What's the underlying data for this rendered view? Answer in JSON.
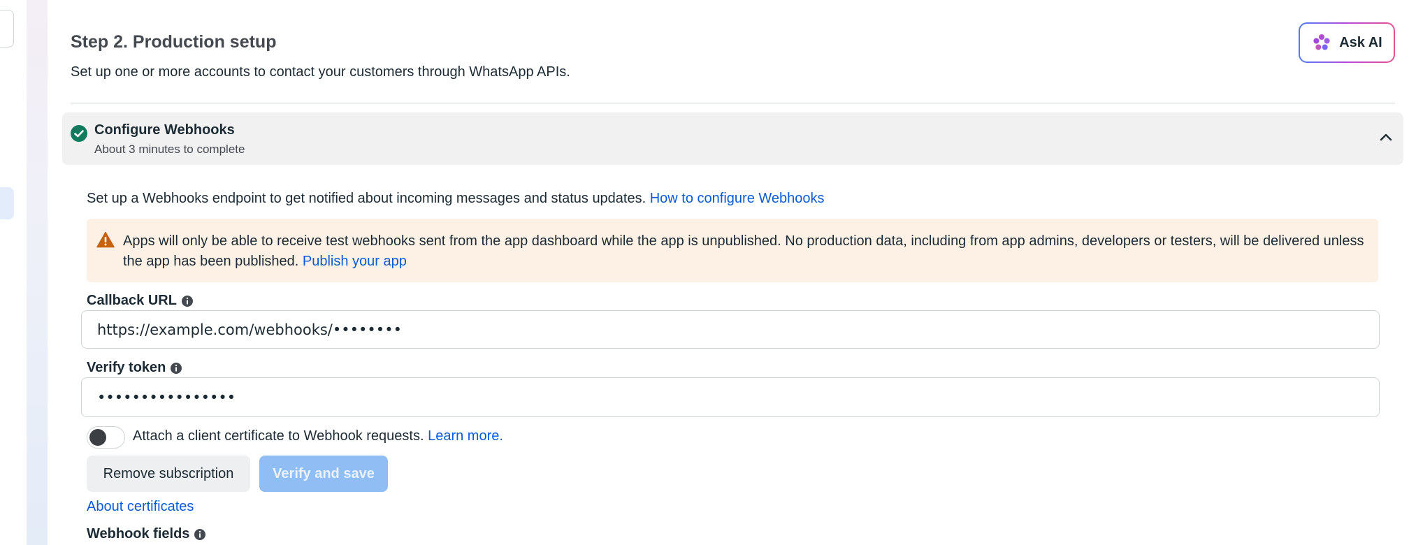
{
  "page": {
    "title": "Step 2. Production setup",
    "subtitle": "Set up one or more accounts to contact your customers through WhatsApp APIs."
  },
  "ask_ai": {
    "label": "Ask AI",
    "icon": "sparkle-flower-icon"
  },
  "section": {
    "title": "Configure Webhooks",
    "subtitle": "About 3 minutes to complete",
    "status_icon": "check-circle-icon",
    "status_color": "#0f7a5c"
  },
  "intro": {
    "text": "Set up a Webhooks endpoint to get notified about incoming messages and status updates. ",
    "link": "How to configure Webhooks"
  },
  "warning": {
    "icon": "warning-triangle-icon",
    "text": "Apps will only be able to receive test webhooks sent from the app dashboard while the app is unpublished. No production data, including from app admins, developers or testers, will be delivered unless the app has been published. ",
    "link": "Publish your app"
  },
  "callback_url": {
    "label": "Callback URL",
    "value": "https://example.com/webhooks/••••••••"
  },
  "verify_token": {
    "label": "Verify token",
    "value": "••••••••••••••••"
  },
  "client_cert": {
    "label": "Attach a client certificate to Webhook requests. ",
    "link": "Learn more.",
    "enabled": false
  },
  "buttons": {
    "remove": "Remove subscription",
    "verify": "Verify and save"
  },
  "about_certificates": "About certificates",
  "webhook_fields": {
    "label": "Webhook fields"
  },
  "colors": {
    "link": "#0a5bd6",
    "warning_bg": "#fdf1e6",
    "warning_icon": "#c4620f",
    "primary_disabled": "#8fbdf4"
  }
}
